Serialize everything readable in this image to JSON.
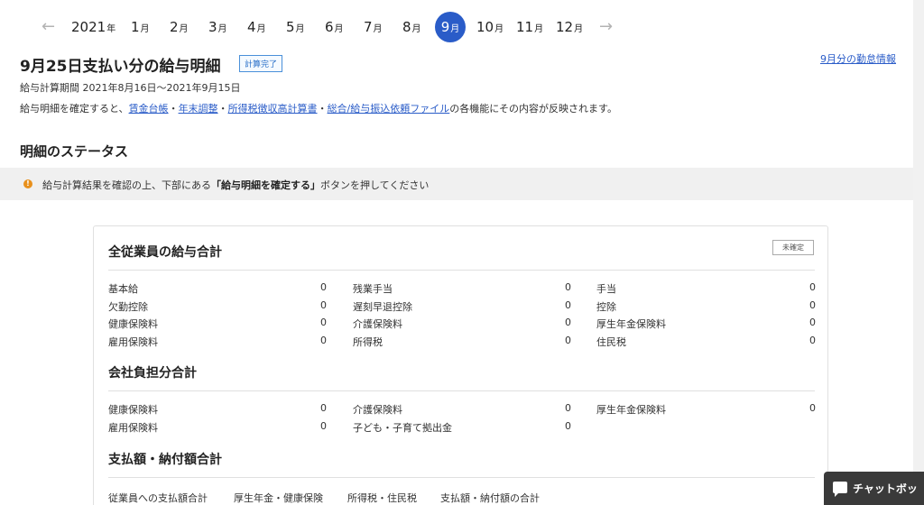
{
  "month_nav": {
    "prev_icon": "arrow-left-icon",
    "next_icon": "arrow-right-icon",
    "year": "2021",
    "year_suffix": "年",
    "month_suffix": "月",
    "months": [
      "1",
      "2",
      "3",
      "4",
      "5",
      "6",
      "7",
      "8",
      "9",
      "10",
      "11",
      "12"
    ],
    "active_month": "9",
    "active_color": "#2a5cc8"
  },
  "header": {
    "title": "9月25日支払い分の給与明細",
    "status_tag": "計算完了",
    "attendance_link": "9月分の勤怠情報",
    "period": "給与計算期間 2021年8月16日〜2021年9月15日",
    "notice_prefix": "給与明細を確定すると、",
    "links": [
      "賃金台帳",
      "年末調整",
      "所得税徴収高計算書",
      "総合/給与振込依頼ファイル"
    ],
    "sep": "・",
    "notice_suffix": "の各機能にその内容が反映されます。"
  },
  "status_section": {
    "title": "明細のステータス",
    "alert_icon": "info-icon",
    "alert_color": "#e8901c",
    "alert_prefix": "給与計算結果を確認の上、下部にある",
    "alert_bold": "「給与明細を確定する」",
    "alert_suffix": "ボタンを押してください"
  },
  "summary_card": {
    "employees_title": "全従業員の給与合計",
    "unconfirmed_badge": "未確定",
    "employee_rows": [
      [
        {
          "label": "基本給",
          "value": "0"
        },
        {
          "label": "残業手当",
          "value": "0"
        },
        {
          "label": "手当",
          "value": "0"
        }
      ],
      [
        {
          "label": "欠勤控除",
          "value": "0"
        },
        {
          "label": "遅刻早退控除",
          "value": "0"
        },
        {
          "label": "控除",
          "value": "0"
        }
      ],
      [
        {
          "label": "健康保険料",
          "value": "0"
        },
        {
          "label": "介護保険料",
          "value": "0"
        },
        {
          "label": "厚生年金保険料",
          "value": "0"
        }
      ],
      [
        {
          "label": "雇用保険料",
          "value": "0"
        },
        {
          "label": "所得税",
          "value": "0"
        },
        {
          "label": "住民税",
          "value": "0"
        }
      ]
    ],
    "company_title": "会社負担分合計",
    "company_rows": [
      [
        {
          "label": "健康保険料",
          "value": "0"
        },
        {
          "label": "介護保険料",
          "value": "0"
        },
        {
          "label": "厚生年金保険料",
          "value": "0"
        }
      ],
      [
        {
          "label": "雇用保険料",
          "value": "0"
        },
        {
          "label": "子ども・子育て拠出金",
          "value": "0"
        }
      ]
    ],
    "payment_title": "支払額・納付額合計",
    "payment_headers": [
      "従業員への支払額合計",
      "厚生年金・健康保険",
      "所得税・住民税",
      "支払額・納付額の合計"
    ]
  },
  "chatbot": {
    "icon": "chat-bubble-icon",
    "label": "チャットボッ"
  }
}
